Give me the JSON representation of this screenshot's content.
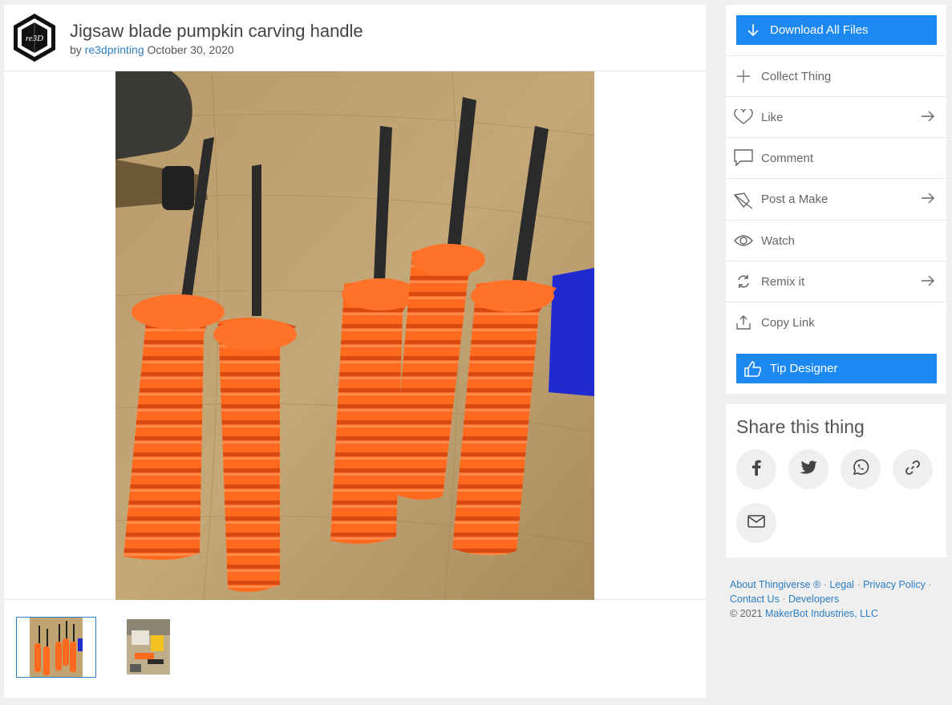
{
  "thing": {
    "title": "Jigsaw blade pumpkin carving handle",
    "by_prefix": "by",
    "author": "re3dprinting",
    "date": "October 30, 2020",
    "logo_text": "re3D"
  },
  "actions": {
    "download_label": "Download All Files",
    "collect_label": "Collect Thing",
    "like_label": "Like",
    "comment_label": "Comment",
    "post_make_label": "Post a Make",
    "watch_label": "Watch",
    "remix_label": "Remix it",
    "copy_link_label": "Copy Link",
    "tip_label": "Tip Designer"
  },
  "share": {
    "title": "Share this thing",
    "buttons": [
      "facebook-icon",
      "twitter-icon",
      "whatsapp-icon",
      "link-icon",
      "email-icon"
    ]
  },
  "footer": {
    "about": "About Thingiverse ®",
    "legal": "Legal",
    "privacy": "Privacy Policy",
    "contact": "Contact Us",
    "developers": "Developers",
    "copyright_prefix": "© 2021",
    "company": "MakerBot Industries, LLC",
    "separator": "·"
  },
  "colors": {
    "accent": "#1e88f1",
    "link": "#2c7dc3",
    "handle_orange": "#ff6a1f"
  }
}
